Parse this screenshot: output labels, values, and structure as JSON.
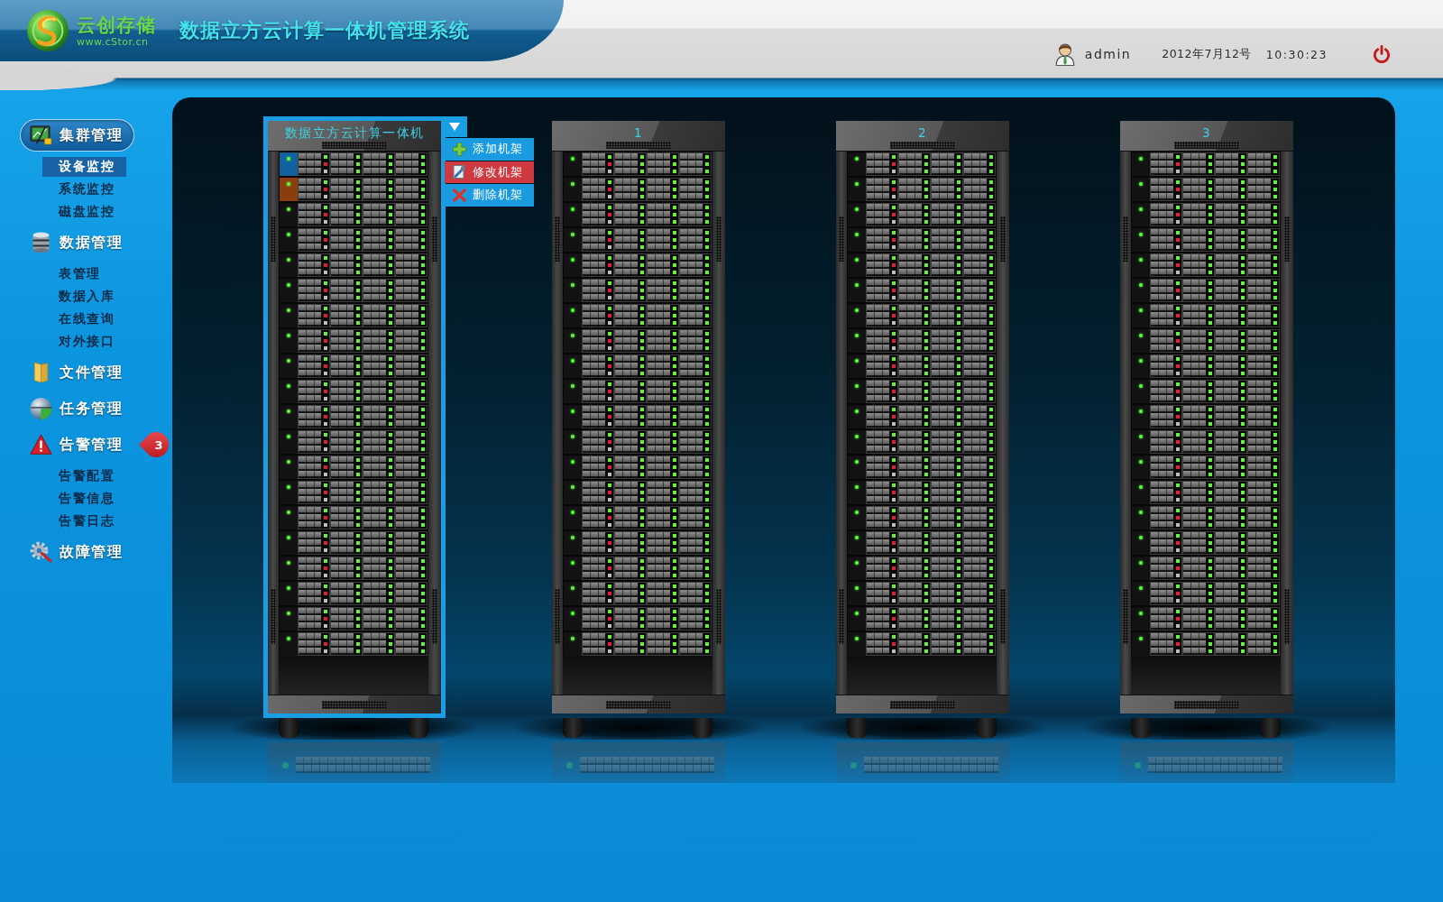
{
  "header": {
    "brand": {
      "name": "云创存储",
      "url": "www.cStor.cn"
    },
    "title": "数据立方云计算一体机管理系统",
    "user": "admin",
    "date": "2012年7月12号",
    "time": "10:30:23"
  },
  "sidebar": {
    "groups": [
      {
        "kind": "cluster",
        "label": "集群管理",
        "selected": true,
        "children": [
          {
            "label": "设备监控",
            "selected": true
          },
          {
            "label": "系统监控",
            "selected": false
          },
          {
            "label": "磁盘监控",
            "selected": false
          }
        ]
      },
      {
        "kind": "data",
        "label": "数据管理",
        "selected": false,
        "children": [
          {
            "label": "表管理",
            "selected": false
          },
          {
            "label": "数据入库",
            "selected": false
          },
          {
            "label": "在线查询",
            "selected": false
          },
          {
            "label": "对外接口",
            "selected": false
          }
        ]
      },
      {
        "kind": "file",
        "label": "文件管理",
        "selected": false
      },
      {
        "kind": "task",
        "label": "任务管理",
        "selected": false
      },
      {
        "kind": "alarm",
        "label": "告警管理",
        "selected": false,
        "badge": "3",
        "children": [
          {
            "label": "告警配置",
            "selected": false
          },
          {
            "label": "告警信息",
            "selected": false
          },
          {
            "label": "告警日志",
            "selected": false
          }
        ]
      },
      {
        "kind": "fault",
        "label": "故障管理",
        "selected": false
      }
    ]
  },
  "racks": [
    {
      "label": "数据立方云计算一体机",
      "selected": true,
      "menu": [
        {
          "kind": "add",
          "label": "添加机架",
          "selected": false
        },
        {
          "kind": "edit",
          "label": "修改机架",
          "selected": true
        },
        {
          "kind": "delete",
          "label": "删除机架",
          "selected": false
        }
      ],
      "units": [
        {
          "selected": true,
          "warning": false
        },
        {
          "selected": false,
          "warning": true
        },
        {
          "selected": false,
          "warning": false
        },
        {
          "selected": false,
          "warning": false
        },
        {
          "selected": false,
          "warning": false
        },
        {
          "selected": false,
          "warning": false
        },
        {
          "selected": false,
          "warning": false
        },
        {
          "selected": false,
          "warning": false
        },
        {
          "selected": false,
          "warning": false
        },
        {
          "selected": false,
          "warning": false
        },
        {
          "selected": false,
          "warning": false
        },
        {
          "selected": false,
          "warning": false
        },
        {
          "selected": false,
          "warning": false
        },
        {
          "selected": false,
          "warning": false
        },
        {
          "selected": false,
          "warning": false
        },
        {
          "selected": false,
          "warning": false
        },
        {
          "selected": false,
          "warning": false
        },
        {
          "selected": false,
          "warning": false
        },
        {
          "selected": false,
          "warning": false
        },
        {
          "selected": false,
          "warning": false
        }
      ]
    },
    {
      "label": "1",
      "selected": false,
      "units": [
        {
          "selected": false,
          "warning": false
        },
        {
          "selected": false,
          "warning": false
        },
        {
          "selected": false,
          "warning": false
        },
        {
          "selected": false,
          "warning": false
        },
        {
          "selected": false,
          "warning": false
        },
        {
          "selected": false,
          "warning": false
        },
        {
          "selected": false,
          "warning": false
        },
        {
          "selected": false,
          "warning": false
        },
        {
          "selected": false,
          "warning": false
        },
        {
          "selected": false,
          "warning": false
        },
        {
          "selected": false,
          "warning": false
        },
        {
          "selected": false,
          "warning": false
        },
        {
          "selected": false,
          "warning": false
        },
        {
          "selected": false,
          "warning": false
        },
        {
          "selected": false,
          "warning": false
        },
        {
          "selected": false,
          "warning": false
        },
        {
          "selected": false,
          "warning": false
        },
        {
          "selected": false,
          "warning": false
        },
        {
          "selected": false,
          "warning": false
        },
        {
          "selected": false,
          "warning": false
        }
      ]
    },
    {
      "label": "2",
      "selected": false,
      "units": [
        {
          "selected": false,
          "warning": false
        },
        {
          "selected": false,
          "warning": false
        },
        {
          "selected": false,
          "warning": false
        },
        {
          "selected": false,
          "warning": false
        },
        {
          "selected": false,
          "warning": false
        },
        {
          "selected": false,
          "warning": false
        },
        {
          "selected": false,
          "warning": false
        },
        {
          "selected": false,
          "warning": false
        },
        {
          "selected": false,
          "warning": false
        },
        {
          "selected": false,
          "warning": false
        },
        {
          "selected": false,
          "warning": false
        },
        {
          "selected": false,
          "warning": false
        },
        {
          "selected": false,
          "warning": false
        },
        {
          "selected": false,
          "warning": false
        },
        {
          "selected": false,
          "warning": false
        },
        {
          "selected": false,
          "warning": false
        },
        {
          "selected": false,
          "warning": false
        },
        {
          "selected": false,
          "warning": false
        },
        {
          "selected": false,
          "warning": false
        },
        {
          "selected": false,
          "warning": false
        }
      ]
    },
    {
      "label": "3",
      "selected": false,
      "units": [
        {
          "selected": false,
          "warning": false
        },
        {
          "selected": false,
          "warning": false
        },
        {
          "selected": false,
          "warning": false
        },
        {
          "selected": false,
          "warning": false
        },
        {
          "selected": false,
          "warning": false
        },
        {
          "selected": false,
          "warning": false
        },
        {
          "selected": false,
          "warning": false
        },
        {
          "selected": false,
          "warning": false
        },
        {
          "selected": false,
          "warning": false
        },
        {
          "selected": false,
          "warning": false
        },
        {
          "selected": false,
          "warning": false
        },
        {
          "selected": false,
          "warning": false
        },
        {
          "selected": false,
          "warning": false
        },
        {
          "selected": false,
          "warning": false
        },
        {
          "selected": false,
          "warning": false
        },
        {
          "selected": false,
          "warning": false
        },
        {
          "selected": false,
          "warning": false
        },
        {
          "selected": false,
          "warning": false
        },
        {
          "selected": false,
          "warning": false
        },
        {
          "selected": false,
          "warning": false
        }
      ]
    }
  ]
}
